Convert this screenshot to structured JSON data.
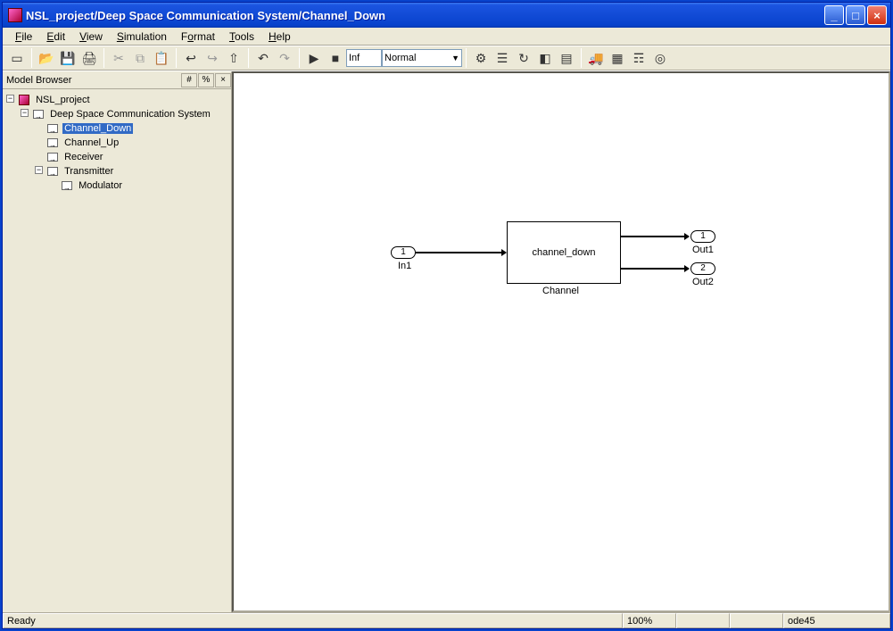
{
  "window": {
    "title": "NSL_project/Deep Space Communication System/Channel_Down"
  },
  "menu": {
    "file": "File",
    "edit": "Edit",
    "view": "View",
    "simulation": "Simulation",
    "format": "Format",
    "tools": "Tools",
    "help": "Help"
  },
  "toolbar": {
    "stoptime": "Inf",
    "mode": "Normal"
  },
  "sidebar": {
    "title": "Model Browser",
    "root": "NSL_project",
    "l1": "Deep Space Communication System",
    "channel_down": "Channel_Down",
    "channel_up": "Channel_Up",
    "receiver": "Receiver",
    "transmitter": "Transmitter",
    "modulator": "Modulator"
  },
  "diagram": {
    "in1_num": "1",
    "in1_label": "In1",
    "block_name": "channel_down",
    "block_label": "Channel",
    "out1_num": "1",
    "out1_label": "Out1",
    "out2_num": "2",
    "out2_label": "Out2"
  },
  "status": {
    "ready": "Ready",
    "zoom": "100%",
    "solver": "ode45"
  }
}
